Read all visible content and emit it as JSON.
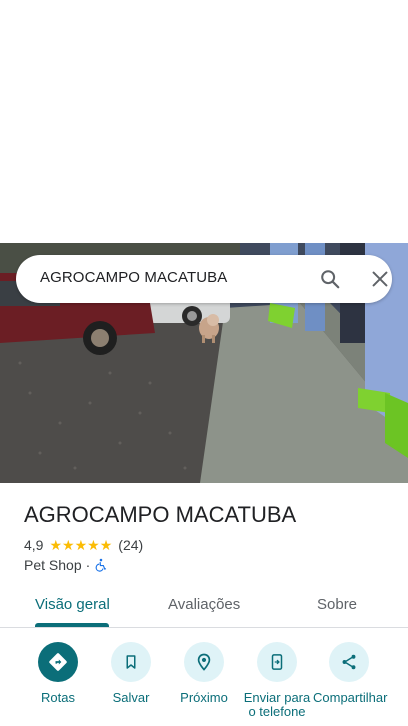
{
  "search": {
    "query": "AGROCAMPO MACATUBA",
    "search_icon": "search-icon",
    "close_icon": "close-icon"
  },
  "place": {
    "title": "AGROCAMPO MACATUBA",
    "rating_value": "4,9",
    "stars": 5,
    "review_count": "(24)",
    "category": "Pet Shop",
    "separator": "·",
    "accessibility_icon": "wheelchair-icon"
  },
  "tabs": [
    {
      "label": "Visão geral",
      "active": true
    },
    {
      "label": "Avaliações",
      "active": false
    },
    {
      "label": "Sobre",
      "active": false
    }
  ],
  "actions": [
    {
      "label": "Rotas",
      "icon": "directions-icon"
    },
    {
      "label": "Salvar",
      "icon": "bookmark-icon"
    },
    {
      "label": "Próximo",
      "icon": "nearby-icon"
    },
    {
      "label": "Enviar para o telefone",
      "icon": "send-to-phone-icon"
    },
    {
      "label": "Compartilhar",
      "icon": "share-icon"
    }
  ],
  "colors": {
    "accent": "#0b6e79",
    "accent_light": "#dff3f7",
    "star": "#fbbc04"
  }
}
